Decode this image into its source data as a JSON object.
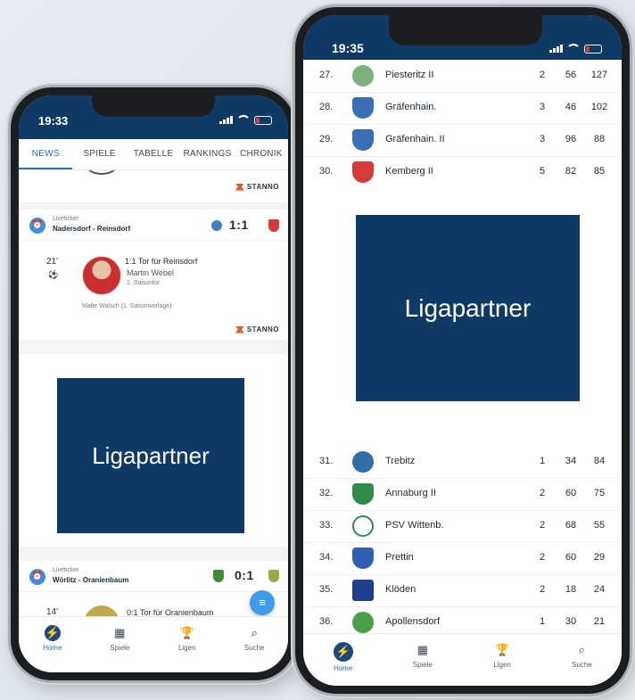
{
  "left_phone": {
    "time": "19:33",
    "tabs": [
      {
        "label": "NEWS",
        "active": true
      },
      {
        "label": "SPIELE",
        "active": false
      },
      {
        "label": "TABELLE",
        "active": false
      },
      {
        "label": "RANKINGS",
        "active": false
      },
      {
        "label": "CHRONIK",
        "active": false
      }
    ],
    "sponsor": "STANNO",
    "liveticker1": {
      "label": "Liveticker",
      "match": "Nadersdorf - Reinsdorf",
      "score": "1:1",
      "event_minute": "21'",
      "event_title": "1:1 Tor für Reinsdorf",
      "player": "Martin Webel",
      "player_note": "1. Saisontor",
      "assist": "Malte Walsch (1. Saisonvorlage)"
    },
    "ad_label": "Ligapartner",
    "liveticker2": {
      "label": "Liveticker",
      "match": "Wörlitz - Oranienbaum",
      "score": "0:1",
      "event_minute": "14'",
      "event_title": "0:1 Tor für Oranienbaum"
    },
    "nav": [
      {
        "label": "Home",
        "icon": "runner-icon",
        "active": true
      },
      {
        "label": "Spiele",
        "icon": "calendar-icon",
        "active": false
      },
      {
        "label": "Ligen",
        "icon": "trophy-icon",
        "active": false
      },
      {
        "label": "Suche",
        "icon": "search-icon",
        "active": false
      }
    ]
  },
  "right_phone": {
    "time": "19:35",
    "table_top": [
      {
        "rank": "27.",
        "team": "Piesteritz II",
        "games": "2",
        "goals": "56",
        "points": "127",
        "crest": "#7bb37a"
      },
      {
        "rank": "28.",
        "team": "Gräfenhain.",
        "games": "3",
        "goals": "46",
        "points": "102",
        "crest": "#3a6fb5"
      },
      {
        "rank": "29.",
        "team": "Gräfenhain. II",
        "games": "3",
        "goals": "96",
        "points": "88",
        "crest": "#3a6fb5"
      },
      {
        "rank": "30.",
        "team": "Kemberg II",
        "games": "5",
        "goals": "82",
        "points": "85",
        "crest": "#d43a3a"
      }
    ],
    "ad_label": "Ligapartner",
    "table_bottom": [
      {
        "rank": "31.",
        "team": "Trebitz",
        "games": "1",
        "goals": "34",
        "points": "84",
        "crest": "#2f6fa8"
      },
      {
        "rank": "32.",
        "team": "Annaburg II",
        "games": "2",
        "goals": "60",
        "points": "75",
        "crest": "#2e8b4a"
      },
      {
        "rank": "33.",
        "team": "PSV Wittenb.",
        "games": "2",
        "goals": "68",
        "points": "55",
        "crest": "#2e8b4a"
      },
      {
        "rank": "34.",
        "team": "Prettin",
        "games": "2",
        "goals": "60",
        "points": "29",
        "crest": "#2f5fb0"
      },
      {
        "rank": "35.",
        "team": "Klöden",
        "games": "2",
        "goals": "18",
        "points": "24",
        "crest": "#1f3f8a"
      },
      {
        "rank": "36.",
        "team": "Apollensdorf",
        "games": "1",
        "goals": "30",
        "points": "21",
        "crest": "#4aa04a"
      }
    ],
    "nav": [
      {
        "label": "Home",
        "icon": "runner-icon",
        "active": true
      },
      {
        "label": "Spiele",
        "icon": "calendar-icon",
        "active": false
      },
      {
        "label": "Ligen",
        "icon": "trophy-icon",
        "active": false
      },
      {
        "label": "Suche",
        "icon": "search-icon",
        "active": false
      }
    ]
  }
}
